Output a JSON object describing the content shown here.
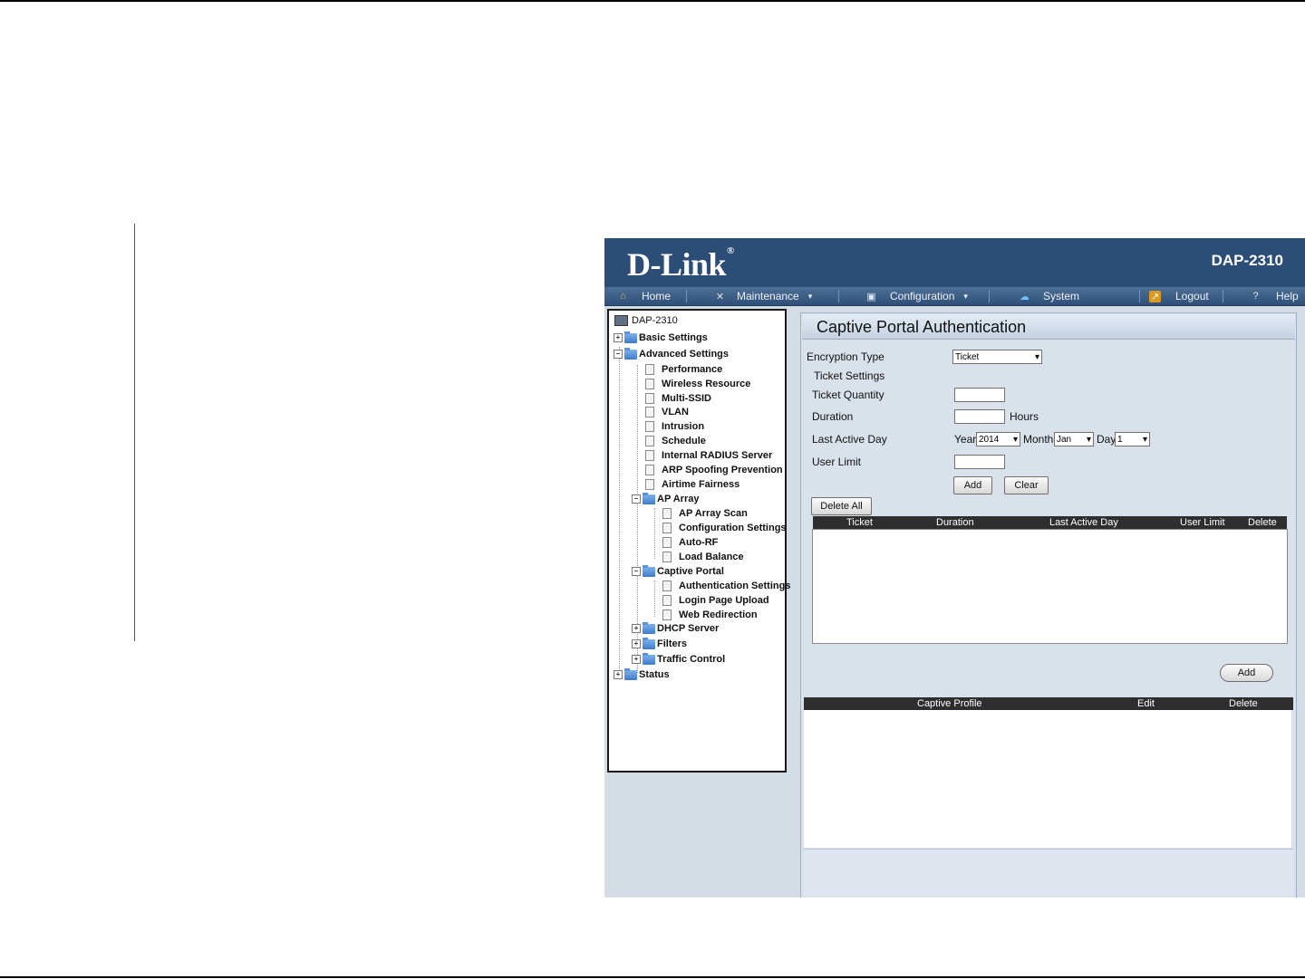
{
  "app": {
    "brand": "D-Link",
    "brand_mark": "®",
    "model": "DAP-2310"
  },
  "nav": {
    "items": [
      {
        "label": "Home",
        "icon": "home-icon"
      },
      {
        "label": "Maintenance",
        "icon": "tools-icon",
        "has_dropdown": true
      },
      {
        "label": "Configuration",
        "icon": "save-icon",
        "has_dropdown": true
      },
      {
        "label": "System",
        "icon": "network-icon"
      },
      {
        "label": "Logout",
        "icon": "logout-icon"
      },
      {
        "label": "Help",
        "icon": "help-icon"
      }
    ],
    "caret": "▾"
  },
  "tree": {
    "root": "DAP-2310",
    "basic_settings": "Basic Settings",
    "advanced_settings": "Advanced Settings",
    "performance": "Performance",
    "wireless_resource": "Wireless Resource",
    "multi_ssid": "Multi-SSID",
    "vlan": "VLAN",
    "intrusion": "Intrusion",
    "schedule": "Schedule",
    "internal_radius": "Internal RADIUS Server",
    "arp_spoofing": "ARP Spoofing Prevention",
    "airtime_fairness": "Airtime Fairness",
    "ap_array": "AP Array",
    "ap_array_scan": "AP Array Scan",
    "configuration_settings": "Configuration Settings",
    "auto_rf": "Auto-RF",
    "load_balance": "Load Balance",
    "captive_portal": "Captive Portal",
    "authentication_settings": "Authentication Settings",
    "login_page_upload": "Login Page Upload",
    "web_redirection": "Web Redirection",
    "dhcp_server": "DHCP Server",
    "filters": "Filters",
    "traffic_control": "Traffic Control",
    "status": "Status",
    "expand_sign": "+",
    "collapse_sign": "−"
  },
  "content": {
    "title": "Captive Portal Authentication",
    "encryption_type_label": "Encryption Type",
    "encryption_type_value": "Ticket",
    "ticket_settings_label": "Ticket Settings",
    "ticket_quantity_label": "Ticket Quantity",
    "duration_label": "Duration",
    "hours_label": "Hours",
    "last_active_day_label": "Last Active Day",
    "year_label": "Year",
    "year_value": "2014",
    "month_label": "Month",
    "month_value": "Jan",
    "day_label": "Day",
    "day_value": "1",
    "user_limit_label": "User Limit",
    "add_label": "Add",
    "clear_label": "Clear",
    "delete_all_label": "Delete All",
    "ticket_table": {
      "columns": [
        "Ticket",
        "Duration",
        "Last Active Day",
        "User Limit",
        "Delete"
      ]
    },
    "profile_add_label": "Add",
    "profile_table": {
      "columns": [
        "Captive Profile",
        "Edit",
        "Delete"
      ]
    }
  }
}
